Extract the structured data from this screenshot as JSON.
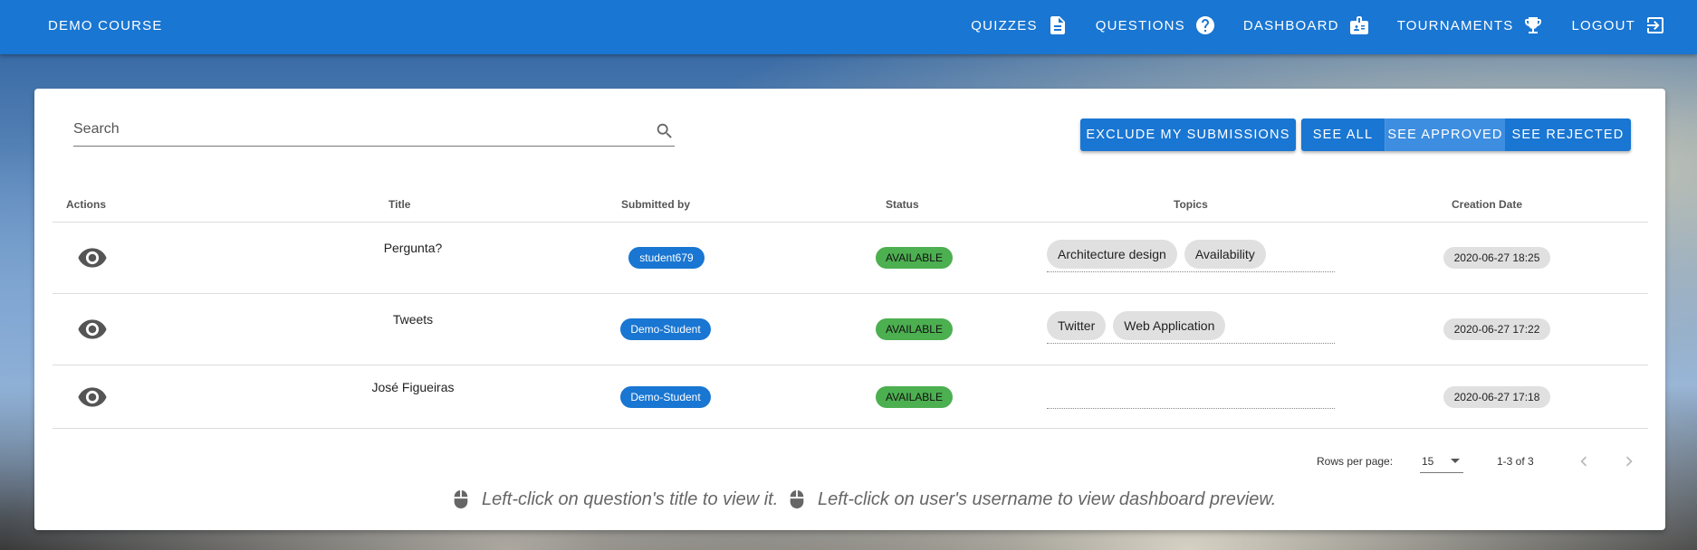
{
  "app": {
    "title": "DEMO COURSE"
  },
  "nav": {
    "quizzes": "QUIZZES",
    "questions": "QUESTIONS",
    "dashboard": "DASHBOARD",
    "tournaments": "TOURNAMENTS",
    "logout": "LOGOUT"
  },
  "search": {
    "placeholder": "Search",
    "value": ""
  },
  "buttons": {
    "exclude": "EXCLUDE MY SUBMISSIONS",
    "see_all": "SEE ALL",
    "see_approved": "SEE APPROVED",
    "see_rejected": "SEE REJECTED"
  },
  "table": {
    "headers": [
      "Actions",
      "Title",
      "Submitted by",
      "Status",
      "Topics",
      "Creation Date"
    ],
    "rows": [
      {
        "title": "Pergunta?",
        "submitted_by": "student679",
        "status": "AVAILABLE",
        "topics": [
          "Architecture design",
          "Availability"
        ],
        "date": "2020-06-27 18:25"
      },
      {
        "title": "Tweets",
        "submitted_by": "Demo-Student",
        "status": "AVAILABLE",
        "topics": [
          "Twitter",
          "Web Application"
        ],
        "date": "2020-06-27 17:22"
      },
      {
        "title": "José Figueiras",
        "submitted_by": "Demo-Student",
        "status": "AVAILABLE",
        "topics": [],
        "date": "2020-06-27 17:18"
      }
    ]
  },
  "pagination": {
    "rows_per_page_label": "Rows per page:",
    "rows_per_page": "15",
    "range": "1-3 of 3"
  },
  "hints": {
    "title_hint": "Left-click on question's title to view it.",
    "user_hint": "Left-click on user's username to view dashboard preview."
  },
  "colors": {
    "primary": "#1976d2",
    "status_available": "#4caf50",
    "chip_gray": "#e0e0e0"
  }
}
